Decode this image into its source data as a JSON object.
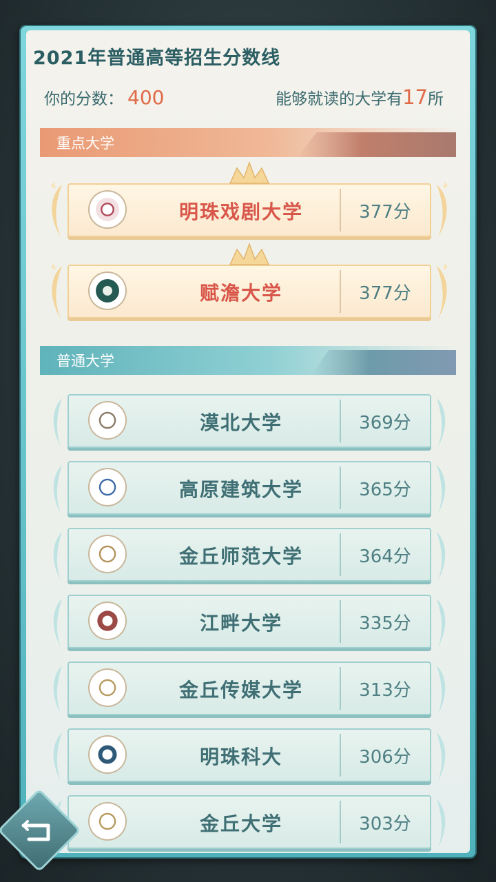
{
  "title": "2021年普通高等招生分数线",
  "score_label": "你的分数：",
  "score_value": "400",
  "count_prefix": "能够就读的大学有",
  "count_value": "17",
  "count_suffix": "所",
  "sections": {
    "key": "重点大学",
    "normal": "普通大学"
  },
  "key_universities": [
    {
      "name": "明珠戏剧大学",
      "score": "377分",
      "logo": "drama-emblem-icon"
    },
    {
      "name": "赋澹大学",
      "score": "377分",
      "logo": "architecture-emblem-icon"
    }
  ],
  "normal_universities": [
    {
      "name": "漠北大学",
      "score": "369分",
      "logo": "mobei-emblem-icon"
    },
    {
      "name": "高原建筑大学",
      "score": "365分",
      "logo": "plateau-emblem-icon"
    },
    {
      "name": "金丘师范大学",
      "score": "364分",
      "logo": "normal-univ-emblem-icon"
    },
    {
      "name": "江畔大学",
      "score": "335分",
      "logo": "riverside-emblem-icon"
    },
    {
      "name": "金丘传媒大学",
      "score": "313分",
      "logo": "media-emblem-icon"
    },
    {
      "name": "明珠科大",
      "score": "306分",
      "logo": "tech-emblem-icon"
    },
    {
      "name": "金丘大学",
      "score": "303分",
      "logo": "jinqiu-emblem-icon"
    }
  ],
  "colors": {
    "accent": "#e06a48",
    "key_name": "#d8574a",
    "teal_text": "#3f6f74"
  },
  "icons": {
    "back": "back-arrow-icon",
    "wings": "laurel-wing-icon",
    "crown": "crown-icon"
  }
}
